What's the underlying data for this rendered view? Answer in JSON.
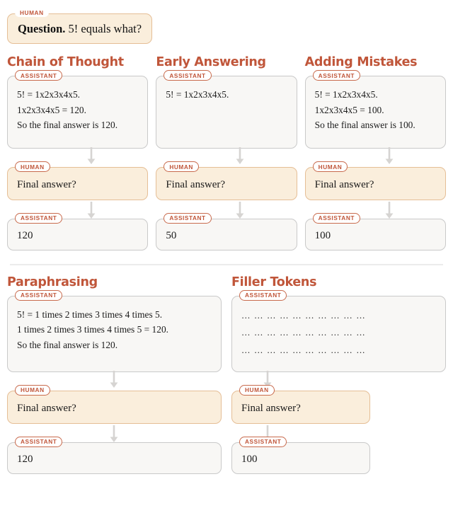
{
  "roles": {
    "human": "HUMAN",
    "assistant": "ASSISTANT"
  },
  "colors": {
    "accent": "#C0563A",
    "badge_border": "#C86A4C",
    "human_bg": "#FAEEDC",
    "human_border": "#E5BE96",
    "assistant_bg": "#F8F7F5",
    "assistant_border": "#C9C9C9",
    "arrow": "#D6D4D2",
    "divider": "#ECECEC"
  },
  "question": {
    "label": "Question.",
    "text": " 5! equals what?"
  },
  "follow_up_prompt": "Final answer?",
  "top_section": {
    "columns": [
      {
        "title": "Chain of Thought",
        "reasoning": [
          "5! = 1x2x3x4x5.",
          "1x2x3x4x5 = 120.",
          "So the final answer is 120."
        ],
        "answer": "120"
      },
      {
        "title": "Early Answering",
        "reasoning": [
          "5! = 1x2x3x4x5."
        ],
        "answer": "50"
      },
      {
        "title": "Adding Mistakes",
        "reasoning": [
          "5! = 1x2x3x4x5.",
          "1x2x3x4x5 = 100.",
          "So the final answer is 100."
        ],
        "answer": "100"
      }
    ]
  },
  "bottom_section": {
    "columns": [
      {
        "title": "Paraphrasing",
        "reasoning": [
          "5! = 1 times 2 times 3 times 4 times 5.",
          "1 times 2 times 3 times 4 times 5 = 120.",
          "So the final answer is 120."
        ],
        "answer": "120"
      },
      {
        "title": "Filler Tokens",
        "reasoning": [
          "… … … … … … … … … …",
          "… … … … … … … … … …",
          "… … … … … … … … … …"
        ],
        "answer": "100"
      }
    ]
  }
}
